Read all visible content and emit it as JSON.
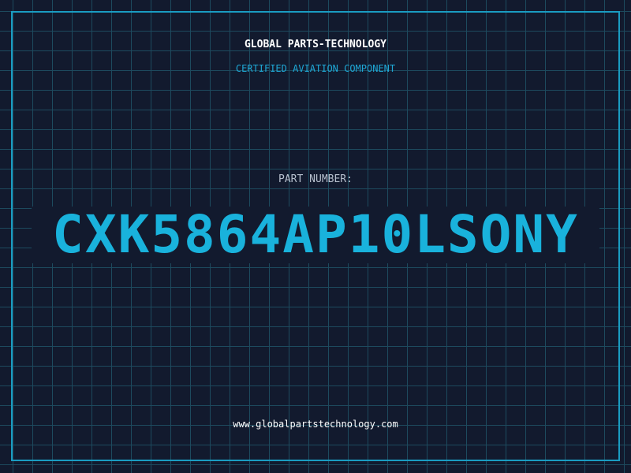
{
  "header": {
    "brand": "GLOBAL PARTS-TECHNOLOGY",
    "tagline": "CERTIFIED AVIATION COMPONENT"
  },
  "part": {
    "label": "PART NUMBER:",
    "number": "CXK5864AP10LSONY"
  },
  "footer": {
    "website": "www.globalpartstechnology.com"
  },
  "colors": {
    "background": "#121a2e",
    "grid": "#1d4a5e",
    "frame": "#1a9cc2",
    "accent": "#19b2dc",
    "brand_text": "#ffffff",
    "label_text": "#b7c0ce"
  }
}
